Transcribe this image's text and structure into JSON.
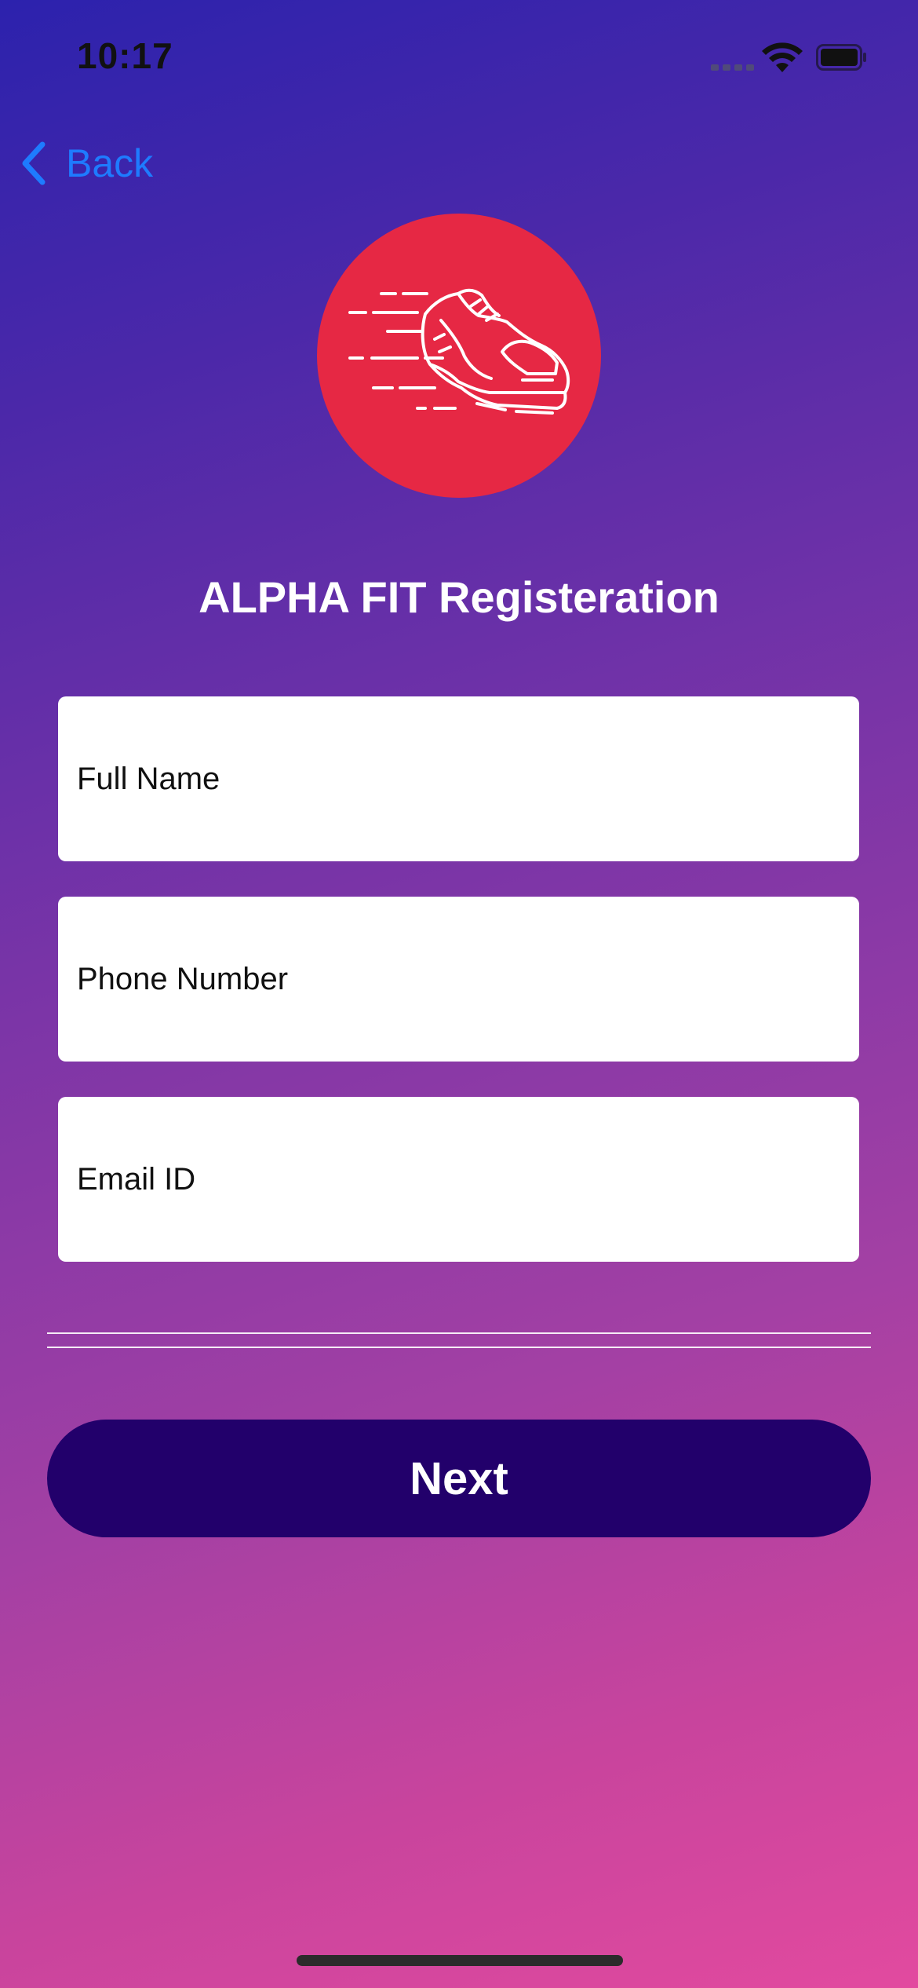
{
  "status_bar": {
    "time": "10:17"
  },
  "nav": {
    "back_label": "Back",
    "back_color": "#1e7bff"
  },
  "logo": {
    "icon": "running-shoe-icon",
    "background_color": "#e62844"
  },
  "form": {
    "title": "ALPHA FIT Registeration",
    "fields": [
      {
        "placeholder": "Full Name",
        "value": ""
      },
      {
        "placeholder": "Phone Number",
        "value": ""
      },
      {
        "placeholder": "Email ID",
        "value": ""
      }
    ]
  },
  "actions": {
    "next_label": "Next",
    "next_color": "#22006b"
  },
  "theme": {
    "gradient_start": "#2c22ad",
    "gradient_end": "#e24a9f"
  }
}
